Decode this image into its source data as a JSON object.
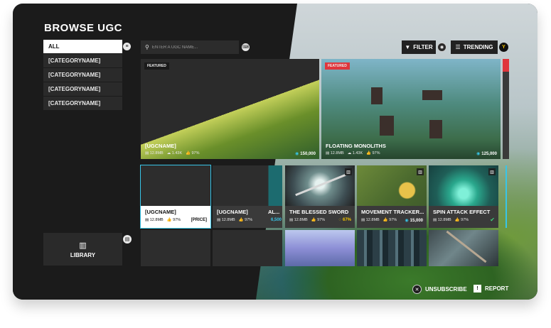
{
  "title": "BROWSE UGC",
  "categories": [
    {
      "label": "ALL",
      "active": true
    },
    {
      "label": "[CATEGORYNAME]",
      "active": false
    },
    {
      "label": "[CATEGORYNAME]",
      "active": false
    },
    {
      "label": "[CATEGORYNAME]",
      "active": false
    },
    {
      "label": "[CATEGORYNAME]",
      "active": false
    }
  ],
  "search": {
    "placeholder": "ENTER A UGC NAME..."
  },
  "toolbar": {
    "filter_label": "FILTER",
    "trending_label": "TRENDING",
    "trending_badge": "Y"
  },
  "library": {
    "label": "LIBRARY"
  },
  "featured": [
    {
      "tag": "FEATURED",
      "name": "[UGCNAME]",
      "size": "12.8MB",
      "downloads": "1.43K",
      "rating": "97%",
      "price": "150,000"
    },
    {
      "tag": "FEATURED",
      "name": "FLOATING MONOLITHS",
      "size": "12.8MB",
      "downloads": "1.43K",
      "rating": "97%",
      "price": "125,000"
    }
  ],
  "grid": [
    {
      "name": "[UGCNAME]",
      "size": "12.8MB",
      "rating": "97%",
      "price": "[PRICE]"
    },
    {
      "name": "[UGCNAME]",
      "size": "12.8MB",
      "rating": "97%",
      "price": ""
    },
    {
      "name": "AL...",
      "size": "",
      "rating": "",
      "price": "6,500"
    },
    {
      "name": "THE BLESSED SWORD",
      "size": "12.8MB",
      "rating": "97%",
      "price": "67%"
    },
    {
      "name": "MOVEMENT TRACKER...",
      "size": "12.8MB",
      "rating": "97%",
      "price": "15,000"
    },
    {
      "name": "SPIN ATTACK EFFECT",
      "size": "12.8MB",
      "rating": "97%",
      "price": "✔"
    }
  ],
  "footer": {
    "unsubscribe_label": "UNSUBSCRIBE",
    "report_label": "REPORT"
  },
  "colors": {
    "accent": "#38c5e8",
    "featured_red": "#e0363c",
    "panel": "#2a2a2a",
    "dark_bg": "#1b1b1b"
  }
}
